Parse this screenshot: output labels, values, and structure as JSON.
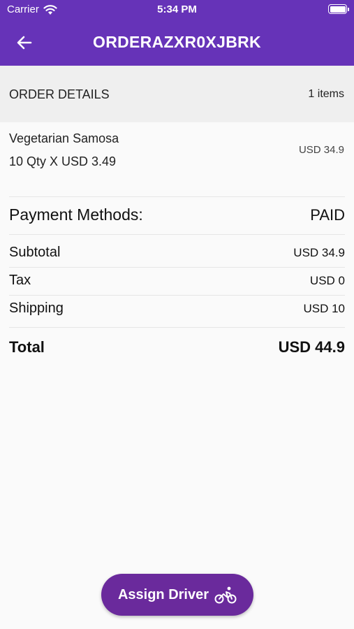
{
  "status_bar": {
    "carrier": "Carrier",
    "time": "5:34 PM"
  },
  "app_bar": {
    "title": "ORDERAZXR0XJBRK",
    "back_icon": "arrow-left-icon"
  },
  "order_details": {
    "header": "ORDER DETAILS",
    "item_count": "1 items"
  },
  "items": [
    {
      "name": "Vegetarian Samosa",
      "qty_line": "10 Qty X USD 3.49",
      "price": "USD 34.9"
    }
  ],
  "summary": {
    "payment_label": "Payment Methods:",
    "payment_value": "PAID",
    "subtotal_label": "Subtotal",
    "subtotal_value": "USD 34.9",
    "tax_label": "Tax",
    "tax_value": "USD 0",
    "shipping_label": "Shipping",
    "shipping_value": "USD 10",
    "total_label": "Total",
    "total_value": "USD 44.9"
  },
  "actions": {
    "assign_driver_label": "Assign Driver",
    "assign_driver_icon": "bicycle-icon"
  },
  "colors": {
    "app_bar": "#6633b8",
    "button": "#6a2a9c",
    "section_bg": "#efefef",
    "page_bg": "#fafafa"
  }
}
